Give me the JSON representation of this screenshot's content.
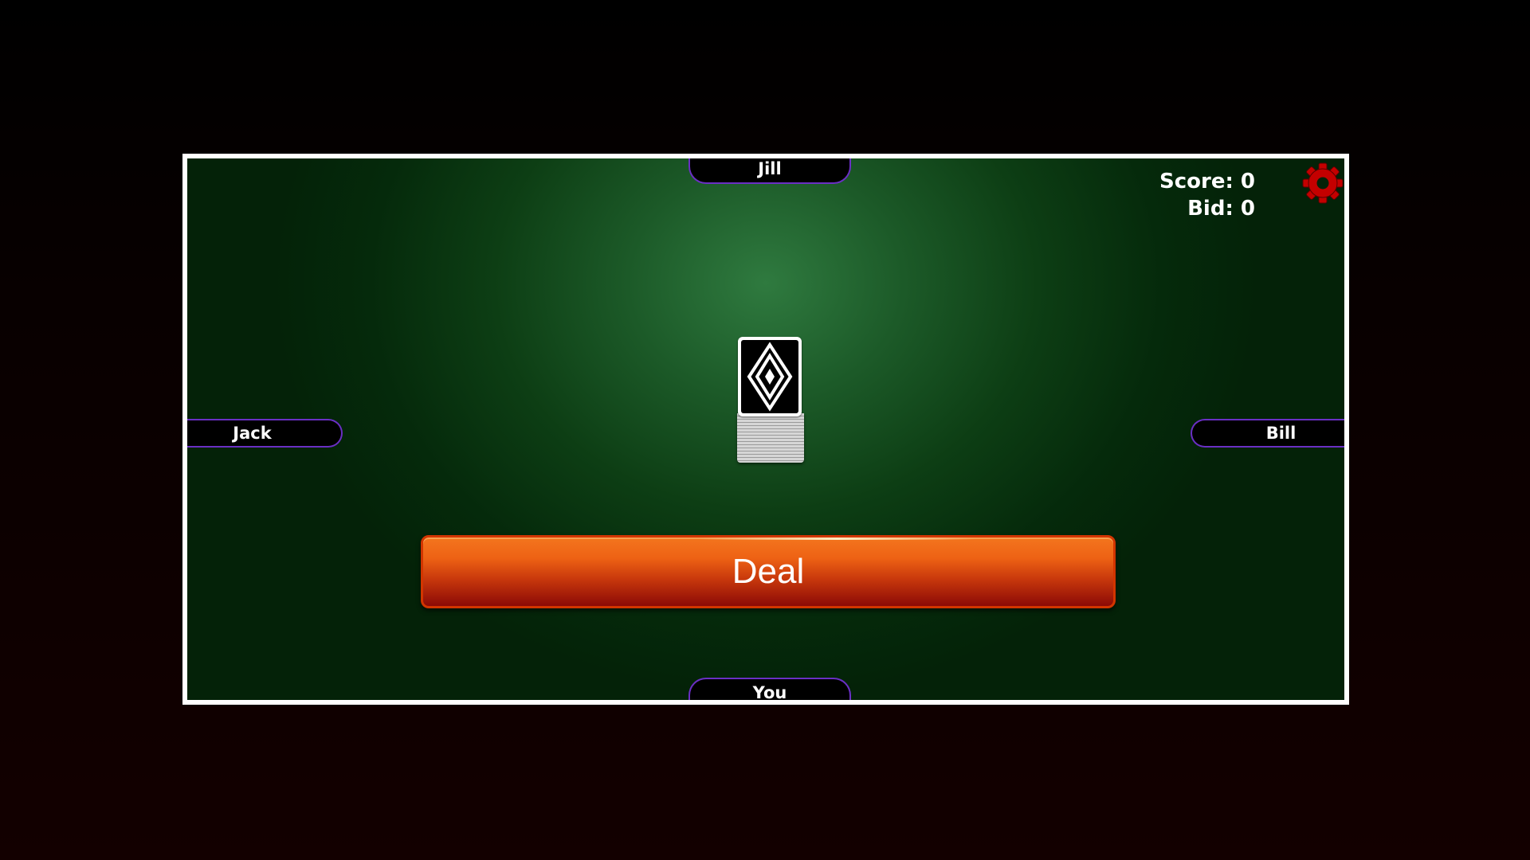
{
  "players": {
    "top": "Jill",
    "left": "Jack",
    "right": "Bill",
    "bottom": "You"
  },
  "status": {
    "score_label": "Score: 0",
    "bid_label": "Bid: 0",
    "score": 0,
    "bid": 0
  },
  "actions": {
    "deal_label": "Deal"
  },
  "icons": {
    "settings": "gear-icon",
    "deck": "card-deck-icon"
  },
  "colors": {
    "table_felt": "#0d3e14",
    "table_border": "#ffffff",
    "name_plate_border": "#6a2fc4",
    "deal_button_top": "#f3751e",
    "deal_button_bottom": "#8c0a06",
    "gear": "#c40000"
  }
}
